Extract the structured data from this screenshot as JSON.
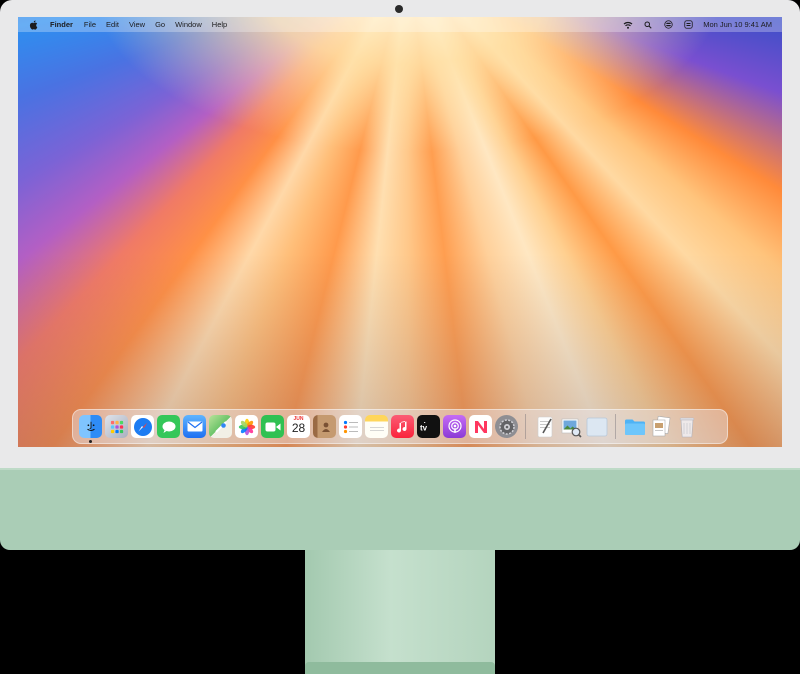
{
  "menubar": {
    "apple_icon": "apple-logo-icon",
    "app_name": "Finder",
    "menus": [
      "File",
      "Edit",
      "View",
      "Go",
      "Window",
      "Help"
    ],
    "status_icons": [
      "wifi-icon",
      "search-icon",
      "control-center-icon",
      "siri-icon"
    ],
    "clock": "Mon Jun 10  9:41 AM"
  },
  "calendar": {
    "month": "JUN",
    "day": "28"
  },
  "dock": {
    "apps": [
      {
        "name": "Finder",
        "icon": "finder-icon",
        "color": "#2f8cf6",
        "running": true
      },
      {
        "name": "Launchpad",
        "icon": "launchpad-icon",
        "color": "#9aa3b5"
      },
      {
        "name": "Safari",
        "icon": "safari-icon",
        "color": "#1d7cf2"
      },
      {
        "name": "Messages",
        "icon": "messages-icon",
        "color": "#34c759"
      },
      {
        "name": "Mail",
        "icon": "mail-icon",
        "color": "#2f86f5"
      },
      {
        "name": "Maps",
        "icon": "maps-icon",
        "color": "#6cc46a"
      },
      {
        "name": "Photos",
        "icon": "photos-icon",
        "color": "#ffffff"
      },
      {
        "name": "FaceTime",
        "icon": "facetime-icon",
        "color": "#30c152"
      },
      {
        "name": "Calendar",
        "icon": "calendar-icon",
        "color": "#ffffff"
      },
      {
        "name": "Contacts",
        "icon": "contacts-icon",
        "color": "#b5835a"
      },
      {
        "name": "Reminders",
        "icon": "reminders-icon",
        "color": "#ffffff"
      },
      {
        "name": "Notes",
        "icon": "notes-icon",
        "color": "#ffd65a"
      },
      {
        "name": "Music",
        "icon": "music-icon",
        "color": "#fa3c51"
      },
      {
        "name": "TV",
        "icon": "tv-icon",
        "color": "#111111"
      },
      {
        "name": "Podcasts",
        "icon": "podcasts-icon",
        "color": "#a451e8"
      },
      {
        "name": "News",
        "icon": "news-icon",
        "color": "#ffffff"
      },
      {
        "name": "System Settings",
        "icon": "settings-gear-icon",
        "color": "#8e8e93"
      }
    ],
    "extras": [
      {
        "name": "TextEdit",
        "icon": "textedit-icon"
      },
      {
        "name": "Preview",
        "icon": "preview-icon"
      },
      {
        "name": "Window",
        "icon": "window-icon"
      }
    ],
    "stacks": [
      {
        "name": "Downloads",
        "icon": "folder-icon"
      },
      {
        "name": "Documents",
        "icon": "documents-stack-icon"
      },
      {
        "name": "Trash",
        "icon": "trash-icon"
      }
    ]
  },
  "colors": {
    "bezel": "#e9e9ea",
    "chin": "#aacdb6",
    "stand": "#b4d4be"
  }
}
